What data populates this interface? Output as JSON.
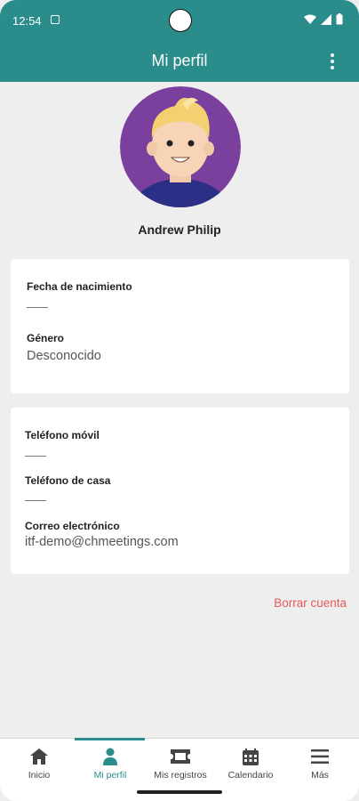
{
  "status_bar": {
    "time": "12:54"
  },
  "app_bar": {
    "title": "Mi perfil"
  },
  "profile": {
    "name": "Andrew Philip"
  },
  "personal_card": {
    "birthdate_label": "Fecha de nacimiento",
    "gender_label": "Género",
    "gender_value": "Desconocido"
  },
  "contact_card": {
    "mobile_label": "Teléfono móvil",
    "home_phone_label": "Teléfono de casa",
    "email_label": "Correo electrónico",
    "email_value": "itf-demo@chmeetings.com"
  },
  "delete_account_label": "Borrar cuenta",
  "bottom_nav": {
    "items": [
      {
        "label": "Inicio",
        "icon": "home-icon"
      },
      {
        "label": "Mi perfil",
        "icon": "person-icon",
        "active": true
      },
      {
        "label": "Mis registros",
        "icon": "ticket-icon"
      },
      {
        "label": "Calendario",
        "icon": "calendar-icon"
      },
      {
        "label": "Más",
        "icon": "menu-icon"
      }
    ]
  },
  "colors": {
    "primary": "#2b8c8c",
    "background": "#eeeeee",
    "danger": "#e35a5a",
    "avatar_bg": "#7b3f9e"
  }
}
